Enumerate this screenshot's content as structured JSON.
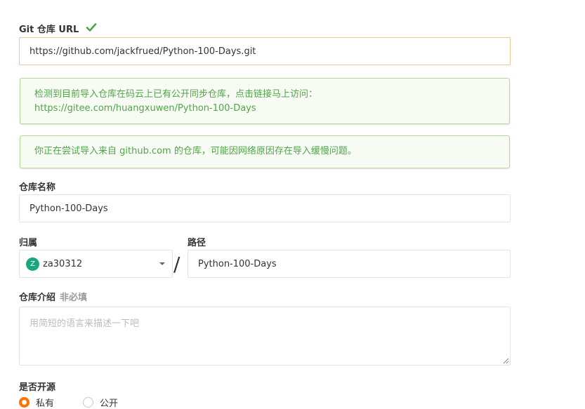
{
  "git_url": {
    "label": "Git 仓库 URL",
    "value": "https://github.com/jackfrued/Python-100-Days.git"
  },
  "alerts": {
    "mirror_line1": "检测到目前导入仓库在码云上已有公开同步仓库，点击链接马上访问：",
    "mirror_link": "https://gitee.com/huangxuwen/Python-100-Days",
    "slow_import": "你正在尝试导入来自 github.com 的仓库，可能因网络原因存在导入缓慢问题。"
  },
  "repo_name": {
    "label": "仓库名称",
    "value": "Python-100-Days"
  },
  "owner": {
    "label": "归属",
    "avatar_letter": "Z",
    "value": "za30312"
  },
  "path": {
    "label": "路径",
    "separator": "/",
    "value": "Python-100-Days"
  },
  "description": {
    "label": "仓库介绍",
    "optional_tag": "非必填",
    "placeholder": "用简短的语言来描述一下吧"
  },
  "open_source": {
    "label": "是否开源",
    "options": [
      {
        "label": "私有",
        "checked": true
      },
      {
        "label": "公开",
        "checked": false
      }
    ]
  },
  "colors": {
    "accent": "#fe7300",
    "success": "#4ea646",
    "avatar": "#1aa67e",
    "focus_border": "#f0c78a"
  },
  "icons": {
    "valid": "check-icon",
    "dropdown": "chevron-down-icon",
    "resize": "resize-handle-icon"
  }
}
